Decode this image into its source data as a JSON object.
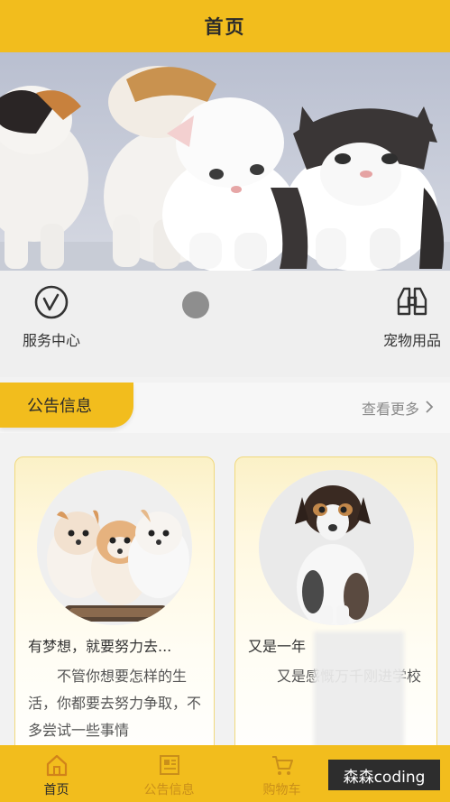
{
  "header": {
    "title": "首页"
  },
  "quick_links": [
    {
      "label": "服务中心",
      "icon": "clock-check-icon"
    },
    {
      "label": "宠物用品",
      "icon": "binoculars-icon"
    }
  ],
  "notice": {
    "title": "公告信息",
    "more_label": "查看更多"
  },
  "cards": [
    {
      "title": "有梦想，就要努力去...",
      "body": "不管你想要怎样的生活，你都要去努力争取，不多尝试一些事情"
    },
    {
      "title": "又是一年",
      "body": "又是感慨万千刚进学校"
    }
  ],
  "tabbar": [
    {
      "label": "首页",
      "icon": "home-icon",
      "active": true
    },
    {
      "label": "公告信息",
      "icon": "newspaper-icon",
      "active": false
    },
    {
      "label": "购物车",
      "icon": "cart-icon",
      "active": false
    }
  ],
  "watermark": "森森coding",
  "colors": {
    "accent": "#f2bd1d",
    "active_tab": "#2b2b2b",
    "inactive_tab": "#c98f1a"
  }
}
